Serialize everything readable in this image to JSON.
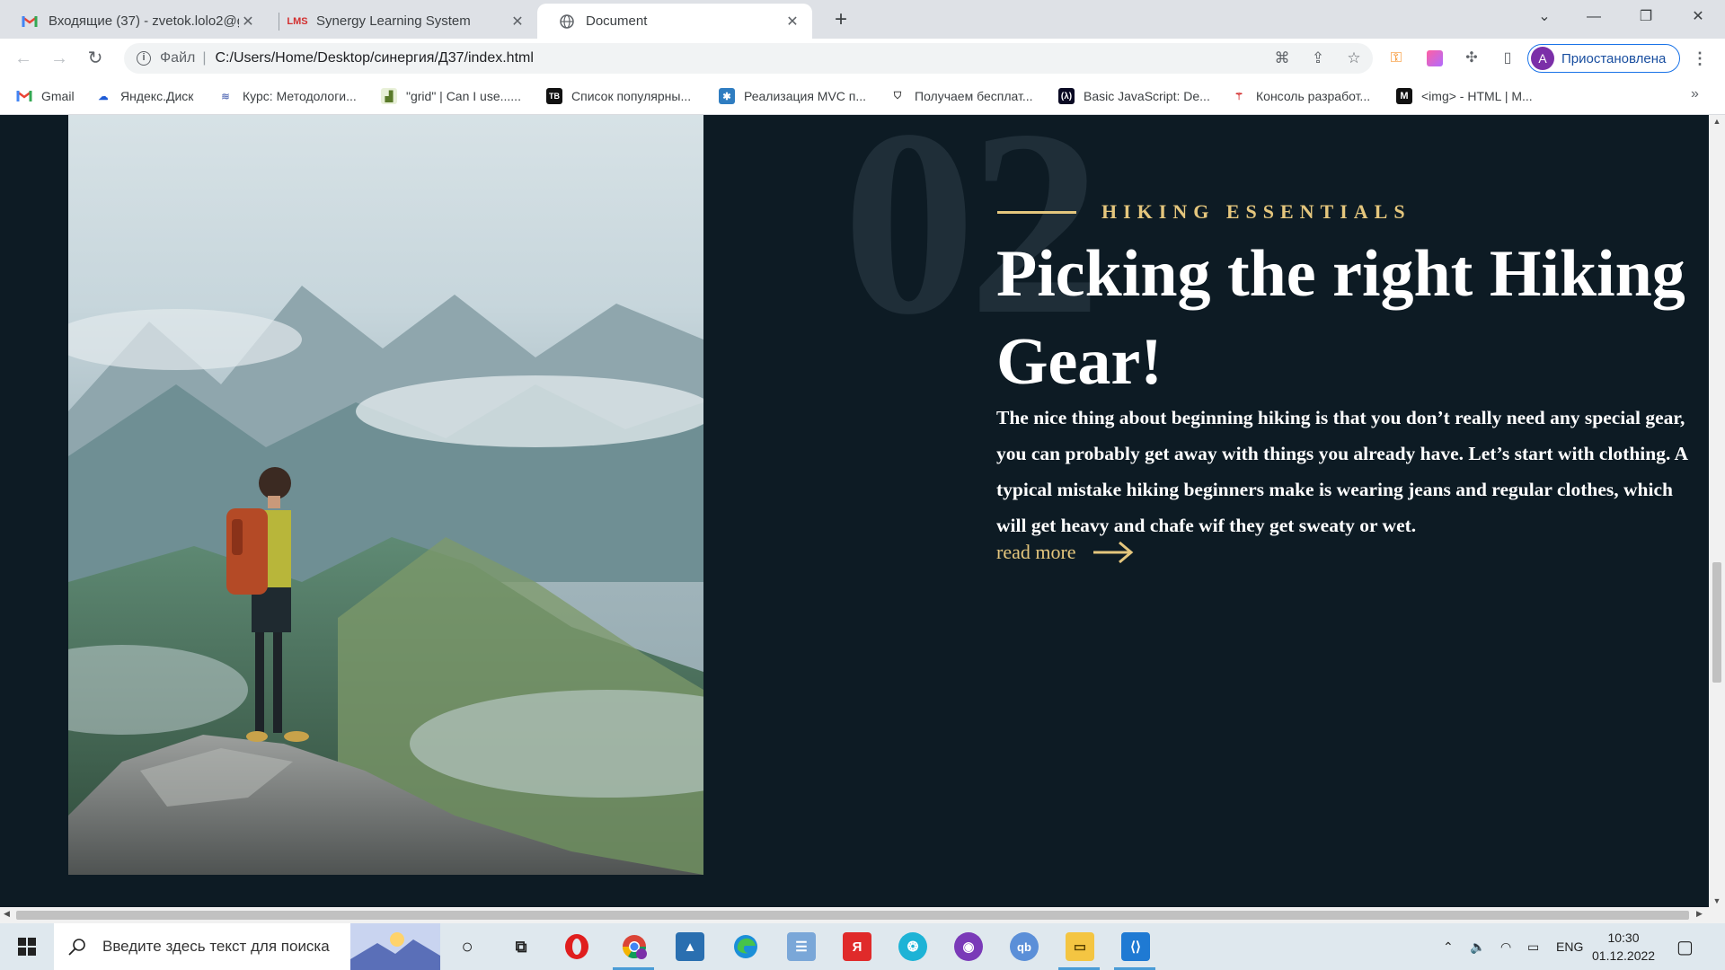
{
  "browser": {
    "tabs": [
      {
        "title": "Входящие (37) - zvetok.lolo2@g",
        "favicon": "gmail-icon",
        "active": false
      },
      {
        "title": "Synergy Learning System",
        "favicon": "synergy-icon",
        "active": false
      },
      {
        "title": "Document",
        "favicon": "globe-icon",
        "active": true
      }
    ],
    "address": {
      "scheme_label": "Файл",
      "url": "C:/Users/Home/Desktop/синергия/Д37/index.html"
    },
    "profile_label": "Приостановлена",
    "profile_initial": "A",
    "bookmarks": [
      {
        "label": "Gmail",
        "icon": "gmail-icon"
      },
      {
        "label": "Яндекс.Диск",
        "icon": "yandex-disk-icon"
      },
      {
        "label": "Курс: Методологи...",
        "icon": "course-icon"
      },
      {
        "label": "\"grid\" | Can I use......",
        "icon": "caniuse-icon"
      },
      {
        "label": "Список популярны...",
        "icon": "tb-icon"
      },
      {
        "label": "Реализация MVC п...",
        "icon": "mvc-icon"
      },
      {
        "label": "Получаем бесплат...",
        "icon": "shield-icon"
      },
      {
        "label": "Basic JavaScript: De...",
        "icon": "freecodecamp-icon"
      },
      {
        "label": "Консоль разработ...",
        "icon": "console-icon"
      },
      {
        "label": "<img> - HTML | M...",
        "icon": "mdn-icon"
      }
    ]
  },
  "page": {
    "section_number": "02",
    "eyebrow": "HIKING ESSENTIALS",
    "heading": "Picking the right Hiking Gear!",
    "paragraph": "The nice thing about beginning hiking is that you don’t really need any special gear, you can probably get away with things you already have. Let’s start with clothing. A typical mistake hiking beginners make is wearing jeans and regular clothes, which will get heavy and chafe wif they get sweaty or wet.",
    "read_more": "read more",
    "colors": {
      "background": "#0d1b24",
      "accent": "#e4c67d",
      "number": "#1f2e38"
    }
  },
  "taskbar": {
    "search_placeholder": "Введите здесь текст для поиска",
    "language": "ENG",
    "time": "10:30",
    "date": "01.12.2022"
  }
}
